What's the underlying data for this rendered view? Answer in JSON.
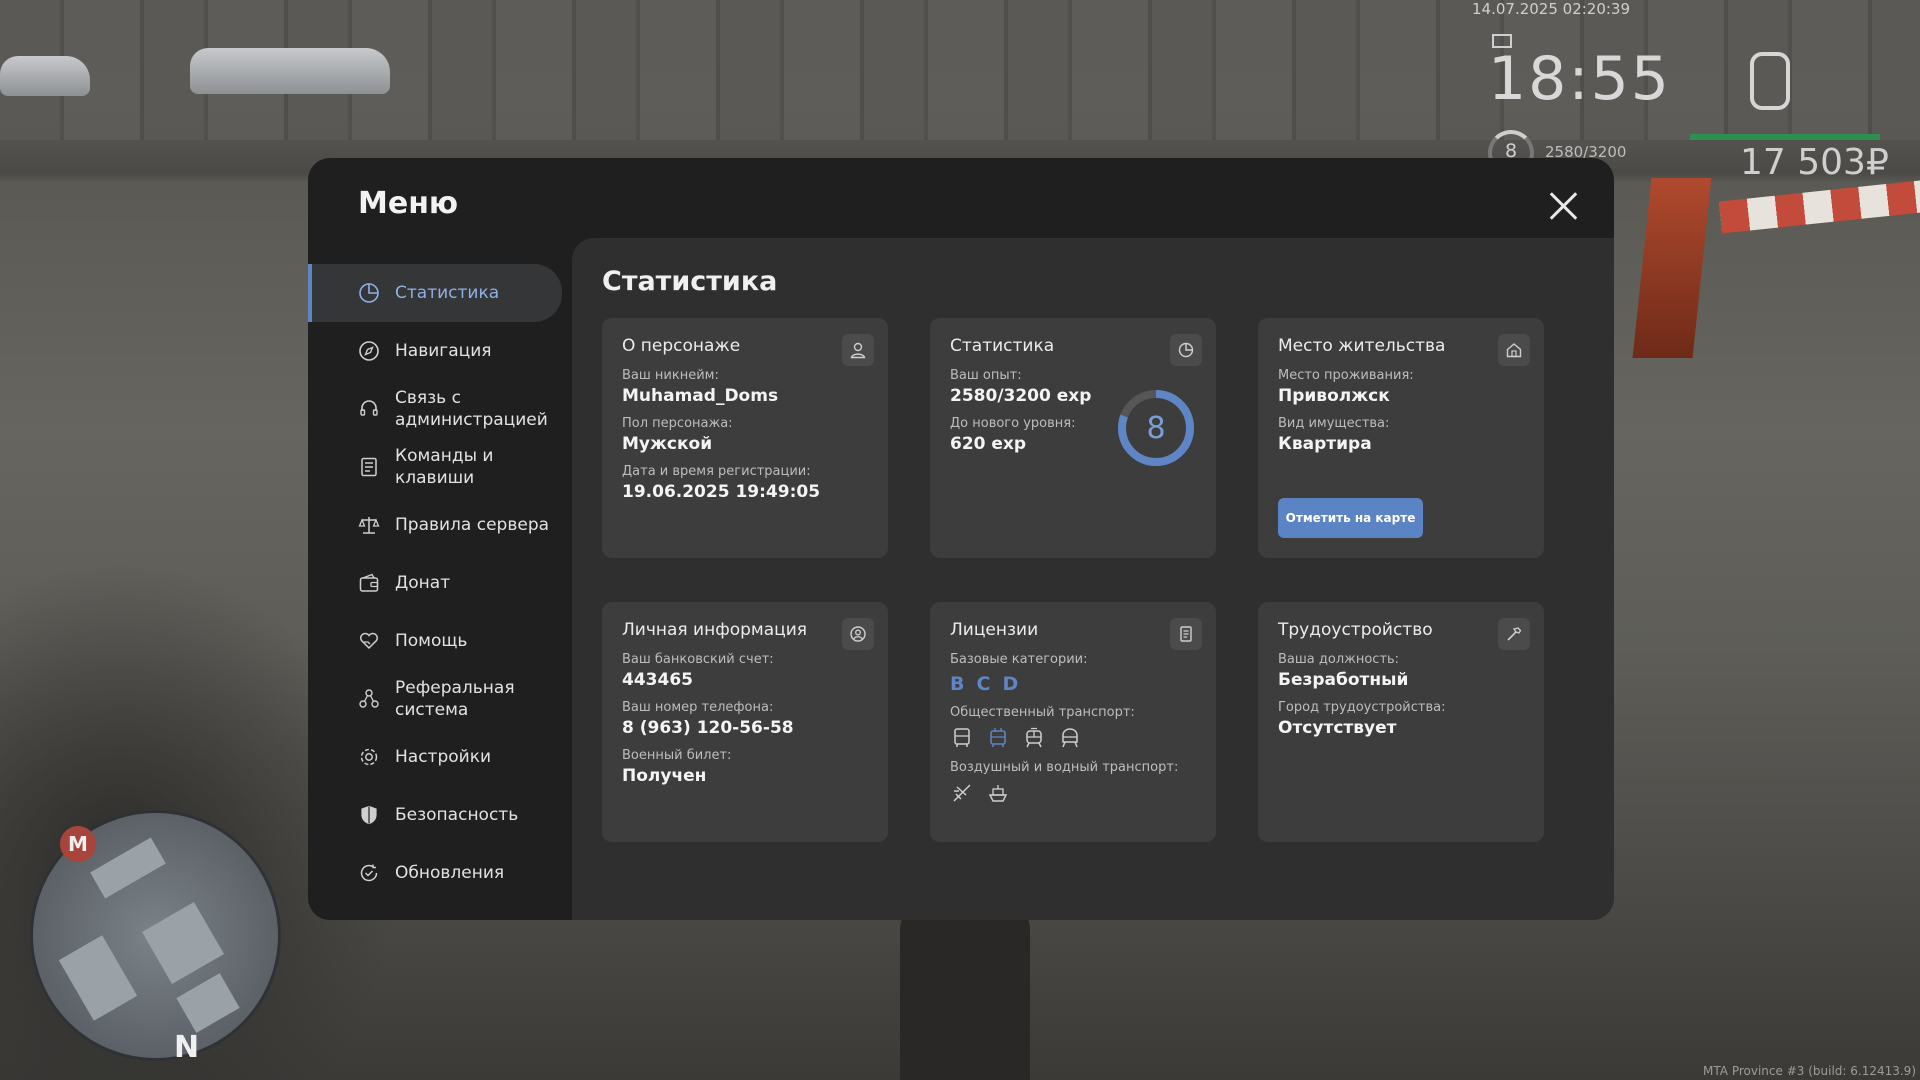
{
  "hud": {
    "datetime": "14.07.2025 02:20:39",
    "time": "18:55",
    "level": "8",
    "exp": "2580/3200",
    "money": "17 503₽",
    "build": "MTA Province #3 (build: 6.12413.9)",
    "minimap_m": "M",
    "minimap_n": "N"
  },
  "menu": {
    "title": "Меню",
    "nav": [
      {
        "label": "Статистика",
        "icon": "pie-chart-icon",
        "active": true
      },
      {
        "label": "Навигация",
        "icon": "compass-icon"
      },
      {
        "label": "Связь с администрацией",
        "icon": "headset-icon"
      },
      {
        "label": "Команды и клавиши",
        "icon": "list-icon"
      },
      {
        "label": "Правила сервера",
        "icon": "scales-icon"
      },
      {
        "label": "Донат",
        "icon": "wallet-icon"
      },
      {
        "label": "Помощь",
        "icon": "heart-hand-icon"
      },
      {
        "label": "Реферальная система",
        "icon": "referral-icon"
      },
      {
        "label": "Настройки",
        "icon": "gear-icon"
      },
      {
        "label": "Безопасность",
        "icon": "shield-icon"
      },
      {
        "label": "Обновления",
        "icon": "refresh-check-icon"
      }
    ]
  },
  "stats": {
    "title": "Статистика",
    "character": {
      "title": "О персонаже",
      "nick_label": "Ваш никнейм:",
      "nick": "Muhamad_Doms",
      "gender_label": "Пол персонажа:",
      "gender": "Мужской",
      "reg_label": "Дата и время регистрации:",
      "reg": "19.06.2025 19:49:05"
    },
    "statistics": {
      "title": "Статистика",
      "exp_label": "Ваш опыт:",
      "exp": "2580/3200 exp",
      "next_label": "До нового уровня:",
      "next": "620 exp",
      "level": "8",
      "level_progress": 0.806
    },
    "residence": {
      "title": "Место жительства",
      "place_label": "Место проживания:",
      "place": "Приволжск",
      "property_label": "Вид имущества:",
      "property": "Квартира",
      "button": "Отметить на карте"
    },
    "personal": {
      "title": "Личная информация",
      "bank_label": "Ваш банковский счет:",
      "bank": "443465",
      "phone_label": "Ваш номер телефона:",
      "phone": "8 (963) 120-56-58",
      "military_label": "Военный билет:",
      "military": "Получен"
    },
    "licenses": {
      "title": "Лицензии",
      "base_label": "Базовые категории:",
      "categories": [
        "B",
        "C",
        "D"
      ],
      "public_label": "Общественный транспорт:",
      "public_icons": [
        "bus-icon",
        "trolleybus-icon",
        "tram-icon",
        "metro-icon"
      ],
      "air_label": "Воздушный и водный транспорт:",
      "air_icons": [
        "plane-icon",
        "ship-icon"
      ]
    },
    "employment": {
      "title": "Трудоустройство",
      "position_label": "Ваша должность:",
      "position": "Безработный",
      "city_label": "Город трудоустройства:",
      "city": "Отсутствует"
    },
    "accent_color": "#5e86c6"
  }
}
